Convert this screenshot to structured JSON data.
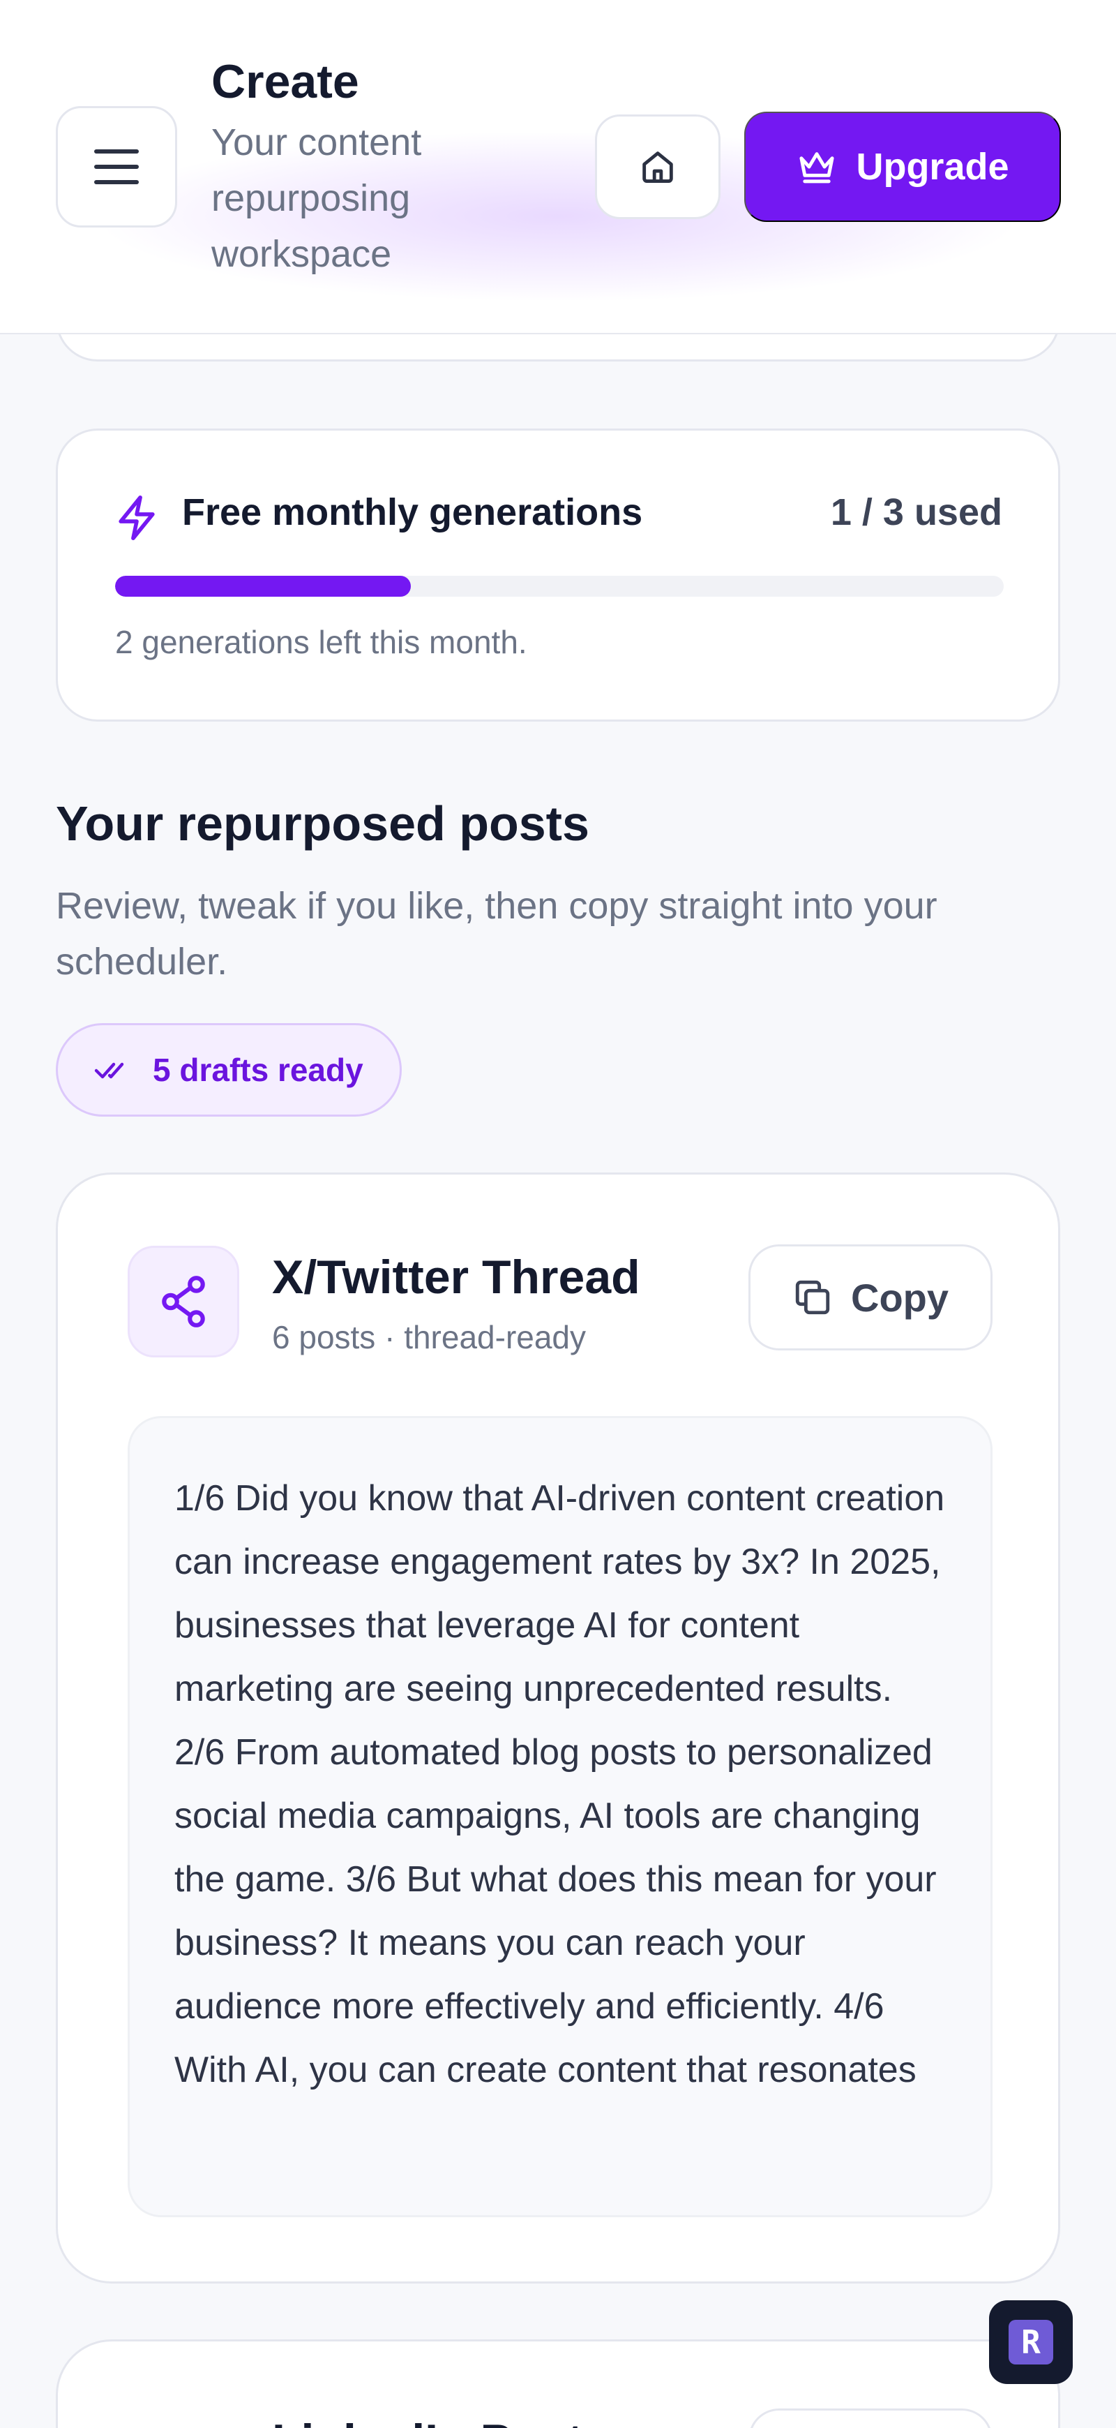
{
  "header": {
    "title": "Create",
    "subtitle": "Your content repurposing workspace",
    "upgrade_label": "Upgrade",
    "menu_icon": "menu-icon",
    "home_icon": "home-icon",
    "upgrade_icon": "crown-icon"
  },
  "usage": {
    "title": "Free monthly generations",
    "count_label": "1 / 3 used",
    "used": 1,
    "limit": 3,
    "progress_fraction": 0.333,
    "note": "2 generations left this month.",
    "icon": "lightning-icon"
  },
  "section": {
    "title": "Your repurposed posts",
    "description": "Review, tweak if you like, then copy straight into your scheduler.",
    "badge_label": "5 drafts ready",
    "badge_icon": "double-check-icon"
  },
  "posts": [
    {
      "title": "X/Twitter Thread",
      "meta": "6 posts · thread-ready",
      "copy_label": "Copy",
      "icon": "share-icon",
      "body": "1/6 Did you know that AI-driven content creation can increase engagement rates by 3x? In 2025, businesses that leverage AI for content marketing are seeing unprecedented results. 2/6 From automated blog posts to personalized social media campaigns, AI tools are changing the game. 3/6 But what does this mean for your business? It means you can reach your audience more effectively and efficiently. 4/6 With AI, you can create content that resonates"
    },
    {
      "title": "LinkedIn Post"
    }
  ],
  "widget": {
    "label": "R"
  },
  "colors": {
    "accent": "#7418f2",
    "badge_bg": "#f5eeff",
    "text_primary": "#141a2e",
    "text_muted": "#6b7385"
  }
}
